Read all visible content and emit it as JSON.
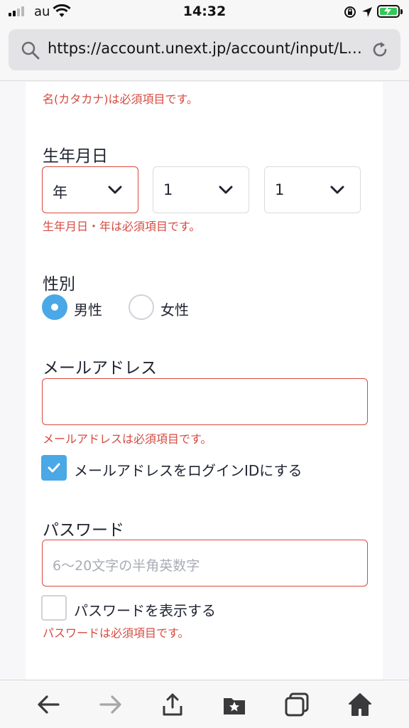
{
  "status_bar": {
    "carrier": "au",
    "time": "14:32",
    "battery_color": "#34c759"
  },
  "browser": {
    "url": "https://account.unext.jp/account/input/L…",
    "icons": [
      "search-icon",
      "reload-icon",
      "back-icon",
      "forward-icon",
      "share-icon",
      "bookmarks-icon",
      "tabs-icon",
      "home-icon"
    ]
  },
  "form": {
    "kana_first_error": "名(カタカナ)は必須項目です。",
    "birthdate": {
      "label": "生年月日",
      "year": "年",
      "month": "1",
      "day": "1",
      "error": "生年月日・年は必須項目です。"
    },
    "gender": {
      "label": "性別",
      "male": "男性",
      "female": "女性",
      "selected": "男性"
    },
    "email": {
      "label": "メールアドレス",
      "value": "",
      "error": "メールアドレスは必須項目です。",
      "use_as_login_label": "メールアドレスをログインIDにする",
      "use_as_login_checked": true
    },
    "password": {
      "label": "パスワード",
      "placeholder": "6〜20文字の半角英数字",
      "show_label": "パスワードを表示する",
      "show_checked": false,
      "error": "パスワードは必須項目です。"
    }
  },
  "colors": {
    "error": "#d64a40",
    "accent": "#4aa8e6"
  }
}
